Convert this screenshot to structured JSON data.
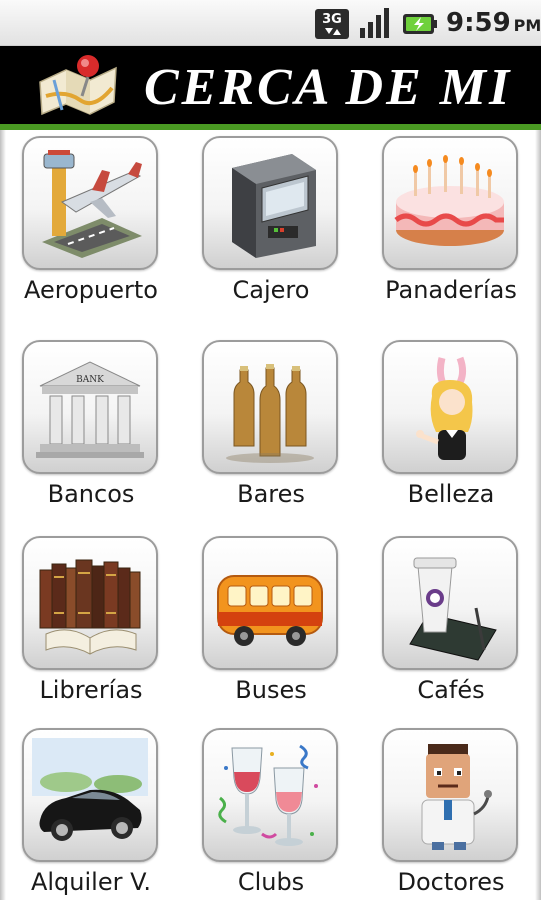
{
  "status_bar": {
    "network": "3G",
    "time": "9:59",
    "ampm": "PM"
  },
  "header": {
    "title": "CERCA DE MI",
    "logo_icon": "map-pin-icon"
  },
  "categories": [
    {
      "label": "Aeropuerto",
      "icon": "airport-icon"
    },
    {
      "label": "Cajero",
      "icon": "atm-icon"
    },
    {
      "label": "Panaderías",
      "icon": "cake-icon"
    },
    {
      "label": "Bancos",
      "icon": "bank-icon"
    },
    {
      "label": "Bares",
      "icon": "beer-bottles-icon"
    },
    {
      "label": "Belleza",
      "icon": "bunny-girl-icon"
    },
    {
      "label": "Librerías",
      "icon": "books-icon"
    },
    {
      "label": "Buses",
      "icon": "bus-icon"
    },
    {
      "label": "Cafés",
      "icon": "coffee-cup-icon"
    },
    {
      "label": "Alquiler V.",
      "icon": "car-icon"
    },
    {
      "label": "Clubs",
      "icon": "wine-glasses-icon"
    },
    {
      "label": "Doctores",
      "icon": "doctor-icon"
    }
  ],
  "bank_sign": "BANK",
  "colors": {
    "header_bg": "#000000",
    "accent_line": "#4a9a23"
  }
}
